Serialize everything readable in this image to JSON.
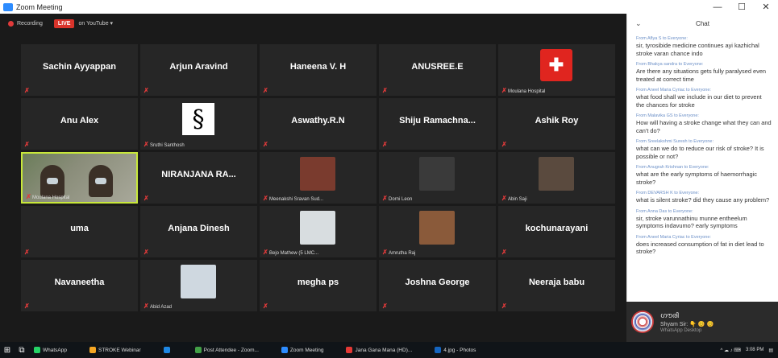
{
  "window": {
    "title": "Zoom Meeting",
    "minimize": "—",
    "maximize": "☐",
    "close": "✕"
  },
  "recording": {
    "label": "Recording",
    "live": "LIVE",
    "platform": "on YouTube ▾"
  },
  "participants": [
    {
      "name": "Sachin Ayyappan",
      "display": "big"
    },
    {
      "name": "Arjun Aravind",
      "display": "big"
    },
    {
      "name": "Haneena V. H",
      "display": "big"
    },
    {
      "name": "ANUSREE.E",
      "display": "big"
    },
    {
      "name": "Moulana Hospital",
      "display": "pic-red"
    },
    {
      "name": "Anu Alex",
      "display": "big"
    },
    {
      "name": "Sruthi Santhosh",
      "display": "pic-s"
    },
    {
      "name": "Aswathy.R.N",
      "display": "big"
    },
    {
      "name": "Shiju  Ramachna...",
      "display": "big"
    },
    {
      "name": "Ashik Roy",
      "display": "big"
    },
    {
      "name": "Moulana Hospital",
      "display": "video"
    },
    {
      "name": "NIRANJANA  RA...",
      "display": "big"
    },
    {
      "name": "Meenakshi Sravan Sud...",
      "display": "photo"
    },
    {
      "name": "Dorni Leon",
      "display": "photo"
    },
    {
      "name": "Abin Saji",
      "display": "photo"
    },
    {
      "name": "uma",
      "display": "big"
    },
    {
      "name": "Anjana Dinesh",
      "display": "big"
    },
    {
      "name": "Bejo Mathew (5 LMC...",
      "display": "photo"
    },
    {
      "name": "Amrutha Raj",
      "display": "photo"
    },
    {
      "name": "kochunarayani",
      "display": "big"
    },
    {
      "name": "Navaneetha",
      "display": "big"
    },
    {
      "name": "Abid Azad",
      "display": "photo"
    },
    {
      "name": "megha ps",
      "display": "big"
    },
    {
      "name": "Joshna George",
      "display": "big"
    },
    {
      "name": "Neeraja babu",
      "display": "big"
    }
  ],
  "chat": {
    "title": "Chat",
    "messages": [
      {
        "from": "From Aflya S to Everyone:",
        "text": "sir, tyrosibide medicine continues ayi kazhichal stroke varan chance indo"
      },
      {
        "from": "From Bhakya sandra to Everyone:",
        "text": "Are there any situations gets fully paralysed even treated at correct time"
      },
      {
        "from": "From Aneel Maria Cyriac to Everyone:",
        "text": "what food shall we include in our diet to prevent the chances for stroke"
      },
      {
        "from": "From Malavika GS to Everyone:",
        "text": "How will having a stroke change what they can and can't do?"
      },
      {
        "from": "From Sreelakshmi Suresh to Everyone:",
        "text": "what can we  do to reduce our risk of stroke?  It is possible or not?"
      },
      {
        "from": "From Anugrah Krishnan to Everyone:",
        "text": "what are the early symptoms of haemorrhagic stroke?"
      },
      {
        "from": "From DEVARSH K to Everyone:",
        "text": "what is silent stroke? did they cause any problem?"
      },
      {
        "from": "From Anna Das to Everyone:",
        "text": "sir, stroke varunnathinu munne entheelum symptoms indavumo? early symptoms"
      },
      {
        "from": "From Aneel Maria Cyriac to Everyone:",
        "text": "does increased consumption of fat in diet lead to stroke?"
      }
    ]
  },
  "notification": {
    "title": "ഗൗരി",
    "body": "Shyam Sir: 👇 😊 😊",
    "source": "WhatsApp Desktop"
  },
  "taskbar": {
    "items": [
      {
        "label": "WhatsApp",
        "color": "#25d366"
      },
      {
        "label": "STROKE Webinar",
        "color": "#f5a623"
      },
      {
        "label": "",
        "color": "#1e88e5"
      },
      {
        "label": "Post Attendee - Zoom...",
        "color": "#43a047"
      },
      {
        "label": "Zoom Meeting",
        "color": "#2d8cff"
      },
      {
        "label": "Jana Gana Mana (HD)...",
        "color": "#e53935"
      },
      {
        "label": "4.jpg - Photos",
        "color": "#1565c0"
      }
    ],
    "time": "3:08 PM"
  }
}
